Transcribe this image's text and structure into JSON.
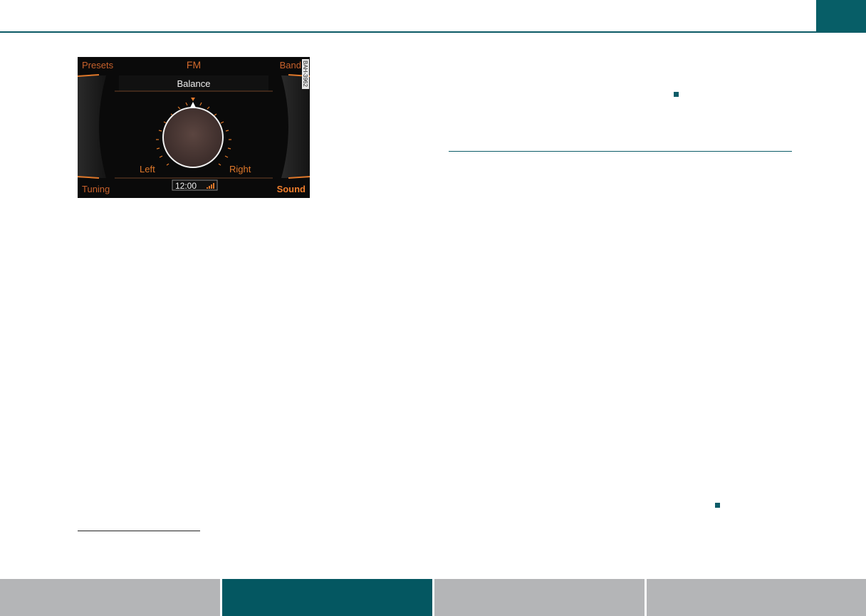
{
  "colors": {
    "accent_teal": "#075e67",
    "nav_inactive": "#b4b5b7",
    "screen_orange": "#e0782a",
    "screen_background": "#0a0a0a"
  },
  "figure": {
    "corner_labels": {
      "top_left": "Presets",
      "top_center": "FM",
      "top_right": "Band",
      "bottom_left": "Tuning",
      "bottom_right": "Sound"
    },
    "title": "Balance",
    "dial": {
      "left_label": "Left",
      "right_label": "Right",
      "balance_position": 0
    },
    "status": {
      "clock": "12:00",
      "signal_icon": "signal-strength-icon"
    },
    "image_code": "BAH-3962"
  },
  "nav_tabs": [
    {
      "label": "",
      "active": false
    },
    {
      "label": "",
      "active": true
    },
    {
      "label": "",
      "active": false
    },
    {
      "label": "",
      "active": false
    }
  ]
}
